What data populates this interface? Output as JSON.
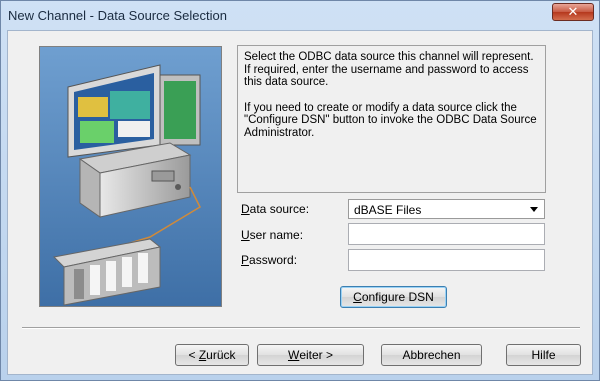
{
  "window": {
    "title": "New Channel - Data Source Selection",
    "close_label": "✕"
  },
  "info": {
    "paragraph1": "Select the ODBC data source this channel will represent.  If required, enter the username and password to access this data source.",
    "paragraph2": "If you need to create or modify a data source click the \"Configure DSN\" button to invoke the ODBC Data Source Administrator."
  },
  "form": {
    "data_source": {
      "label_mnemonic": "D",
      "label_rest": "ata source:",
      "value": "dBASE Files"
    },
    "user_name": {
      "label_mnemonic": "U",
      "label_rest": "ser name:",
      "value": ""
    },
    "password": {
      "label_mnemonic": "P",
      "label_rest": "assword:",
      "value": ""
    },
    "configure_button": {
      "mnemonic": "C",
      "rest": "onfigure DSN"
    }
  },
  "footer": {
    "back": {
      "prefix": "< ",
      "mnemonic": "Z",
      "rest": "urück"
    },
    "next": {
      "mnemonic": "W",
      "rest": "eiter >"
    },
    "cancel": "Abbrechen",
    "help": "Hilfe"
  },
  "colors": {
    "illustration_bg": "#4c7db3",
    "close_button": "#c75a42",
    "title_bar": "#cfe1f5"
  }
}
